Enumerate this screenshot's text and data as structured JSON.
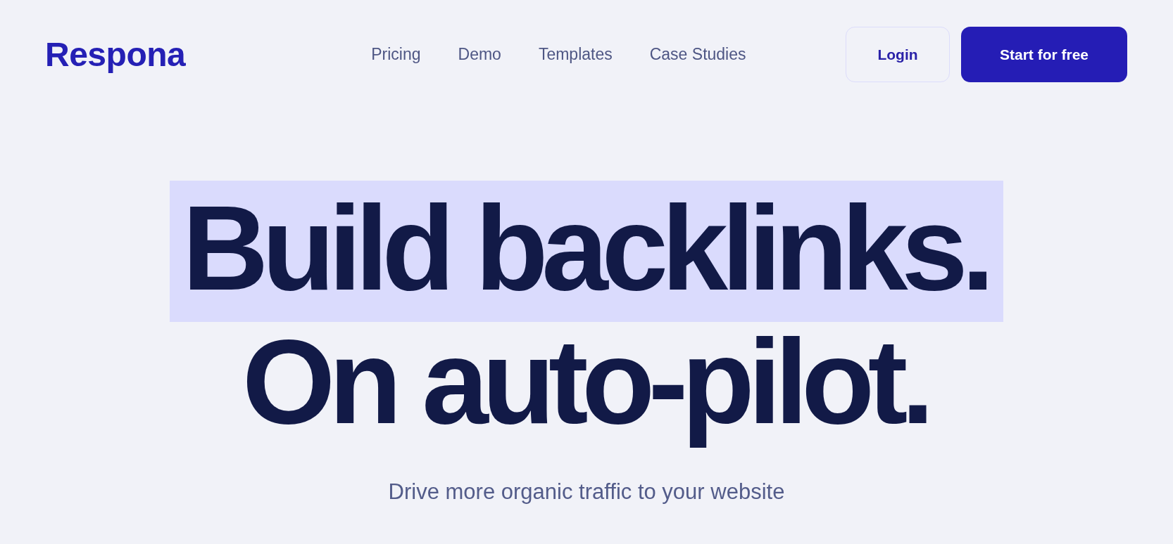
{
  "logo": {
    "text": "Respona"
  },
  "nav": {
    "links": [
      "Pricing",
      "Demo",
      "Templates",
      "Case Studies"
    ]
  },
  "actions": [
    {
      "label": "Login",
      "kind": "secondary"
    },
    {
      "label": "Start for free",
      "kind": "primary"
    }
  ],
  "hero": {
    "headline": [
      {
        "text": "Build backlinks.",
        "highlighted": true
      },
      {
        "text": "On auto-pilot.",
        "highlighted": false
      }
    ],
    "subtitle": "Drive more organic traffic to your website"
  }
}
